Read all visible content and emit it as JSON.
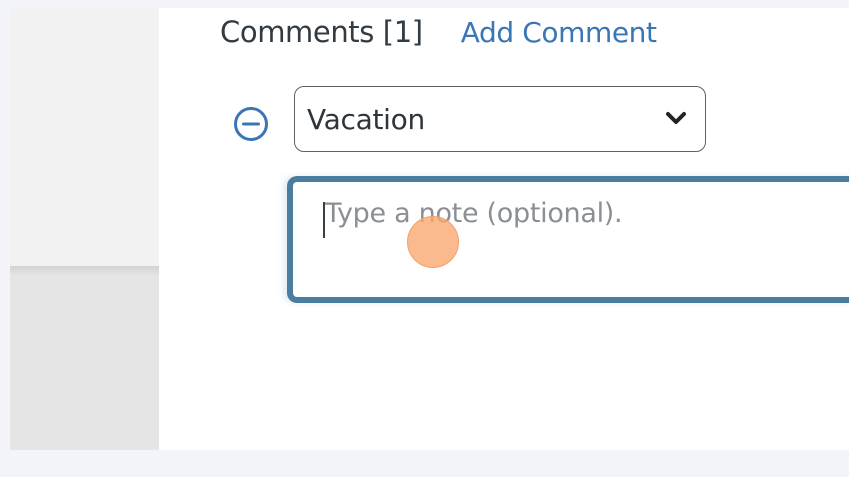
{
  "comments": {
    "title": "Comments [1]",
    "add_link": "Add Comment"
  },
  "comment_entry": {
    "remove_icon": "minus-circle-icon",
    "category": {
      "selected": "Vacation",
      "dropdown_icon": "chevron-down-icon"
    },
    "note": {
      "placeholder": "Type a note (optional).",
      "value": ""
    }
  },
  "colors": {
    "accent": "#3a76b5",
    "focus_border": "#4a7d9f",
    "click_marker": "#f7a56b"
  }
}
